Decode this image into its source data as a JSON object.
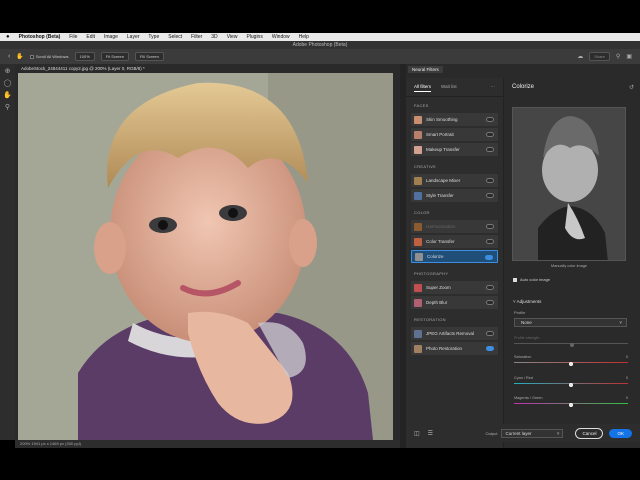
{
  "menubar": {
    "apple": "",
    "app": "Photoshop (Beta)",
    "items": [
      "File",
      "Edit",
      "Image",
      "Layer",
      "Type",
      "Select",
      "Filter",
      "3D",
      "View",
      "Plugins",
      "Window",
      "Help"
    ]
  },
  "window_title": "Adobe Photoshop (Beta)",
  "options": {
    "scroll_all_label": "Scroll All Windows",
    "zoom_label": "100%",
    "fit_screen_label": "Fit Screen",
    "fill_screen_label": "Fill Screen",
    "share_label": "Share"
  },
  "document": {
    "tab_label": "AdobeStock_24844411 copy2.jpg @ 200% (Layer 0, RGB/8) *",
    "status": "200%    1941 px x 1469 px (300 ppi)"
  },
  "panel": {
    "tab_label": "Neural Filters",
    "list_tabs": [
      "All filters",
      "Wait list"
    ],
    "sections": [
      {
        "title": "FACES",
        "filters": [
          {
            "label": "Skin Smoothing",
            "on": false,
            "color": "#c89070"
          },
          {
            "label": "Smart Portrait",
            "on": false,
            "color": "#b8806a"
          },
          {
            "label": "Makeup Transfer",
            "on": false,
            "color": "#d4a090"
          }
        ]
      },
      {
        "title": "CREATIVE",
        "filters": [
          {
            "label": "Landscape Mixer",
            "on": false,
            "color": "#a08050"
          },
          {
            "label": "Style Transfer",
            "on": false,
            "color": "#5070a0"
          }
        ]
      },
      {
        "title": "COLOR",
        "filters": [
          {
            "label": "Harmonization",
            "on": false,
            "color": "#8a5a30",
            "disabled": true
          },
          {
            "label": "Color Transfer",
            "on": false,
            "color": "#c06040"
          },
          {
            "label": "Colorize",
            "on": true,
            "color": "#909090",
            "active": true
          }
        ]
      },
      {
        "title": "PHOTOGRAPHY",
        "filters": [
          {
            "label": "Super Zoom",
            "on": false,
            "color": "#c05050"
          },
          {
            "label": "Depth Blur",
            "on": false,
            "color": "#b06070"
          }
        ]
      },
      {
        "title": "RESTORATION",
        "filters": [
          {
            "label": "JPEG Artifacts Removal",
            "on": false,
            "color": "#607090"
          },
          {
            "label": "Photo Restoration",
            "on": true,
            "color": "#a08060"
          }
        ]
      }
    ],
    "detail": {
      "title": "Colorize",
      "preview_caption": "Manually color image",
      "auto_color_label": "Auto color image",
      "adjustments_label": "Adjustments",
      "profile_label": "Profile",
      "profile_value": "None",
      "profile_strength_label": "Profile strength",
      "saturation_label": "Saturation",
      "saturation_value": "0",
      "cyan_red_label": "Cyan / Red",
      "cyan_red_value": "0",
      "magenta_green_label": "Magenta / Green",
      "magenta_green_value": "0"
    },
    "footer": {
      "output_label": "Output",
      "output_value": "Current layer",
      "cancel_label": "Cancel",
      "ok_label": "OK"
    }
  },
  "colors": {
    "accent": "#3d8ee0",
    "ok_button": "#1473e6"
  }
}
